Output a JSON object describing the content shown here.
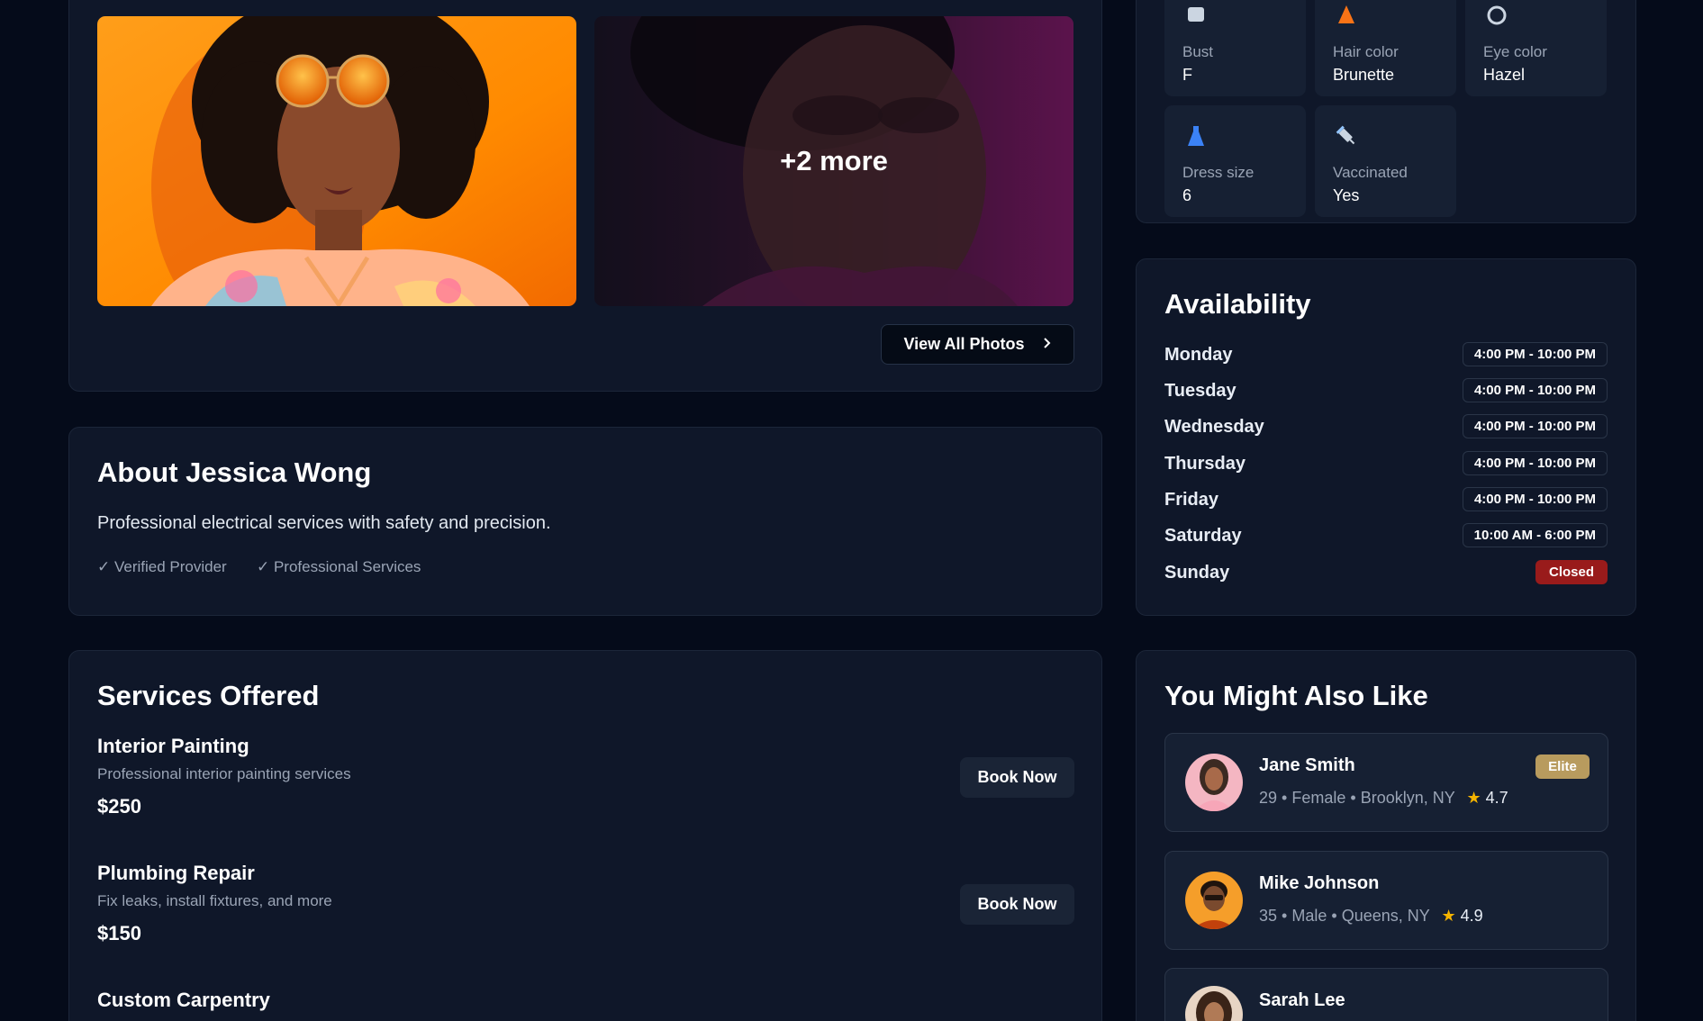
{
  "gallery": {
    "more_label": "+2 more",
    "view_all_label": "View All Photos"
  },
  "attributes": [
    {
      "icon": "bust-icon",
      "label": "Bust",
      "value": "F"
    },
    {
      "icon": "hair-color-icon",
      "label": "Hair color",
      "value": "Brunette"
    },
    {
      "icon": "eye-color-icon",
      "label": "Eye color",
      "value": "Hazel"
    },
    {
      "icon": "dress-icon",
      "label": "Dress size",
      "value": "6"
    },
    {
      "icon": "syringe-icon",
      "label": "Vaccinated",
      "value": "Yes"
    }
  ],
  "about": {
    "title": "About Jessica Wong",
    "description": "Professional electrical services with safety and precision.",
    "tags": [
      "✓ Verified Provider",
      "✓ Professional Services"
    ]
  },
  "availability": {
    "title": "Availability",
    "days": [
      {
        "day": "Monday",
        "hours": "4:00 PM - 10:00 PM"
      },
      {
        "day": "Tuesday",
        "hours": "4:00 PM - 10:00 PM"
      },
      {
        "day": "Wednesday",
        "hours": "4:00 PM - 10:00 PM"
      },
      {
        "day": "Thursday",
        "hours": "4:00 PM - 10:00 PM"
      },
      {
        "day": "Friday",
        "hours": "4:00 PM - 10:00 PM"
      },
      {
        "day": "Saturday",
        "hours": "10:00 AM - 6:00 PM"
      },
      {
        "day": "Sunday",
        "hours": "Closed"
      }
    ]
  },
  "services": {
    "title": "Services Offered",
    "book_label": "Book Now",
    "items": [
      {
        "name": "Interior Painting",
        "description": "Professional interior painting services",
        "price": "$250"
      },
      {
        "name": "Plumbing Repair",
        "description": "Fix leaks, install fixtures, and more",
        "price": "$150"
      },
      {
        "name": "Custom Carpentry",
        "description": "",
        "price": ""
      }
    ]
  },
  "also_like": {
    "title": "You Might Also Like",
    "people": [
      {
        "name": "Jane Smith",
        "age": "29",
        "gender": "Female",
        "location": "Brooklyn, NY",
        "rating": "4.7",
        "badge": "Elite"
      },
      {
        "name": "Mike Johnson",
        "age": "35",
        "gender": "Male",
        "location": "Queens, NY",
        "rating": "4.9"
      },
      {
        "name": "Sarah Lee"
      }
    ],
    "separator": "•",
    "star": "★"
  },
  "colors": {
    "background": "#050b1a",
    "card": "#0f1729",
    "closed": "#991b1b",
    "elite": "#b89b5e",
    "star": "#f5b400"
  }
}
